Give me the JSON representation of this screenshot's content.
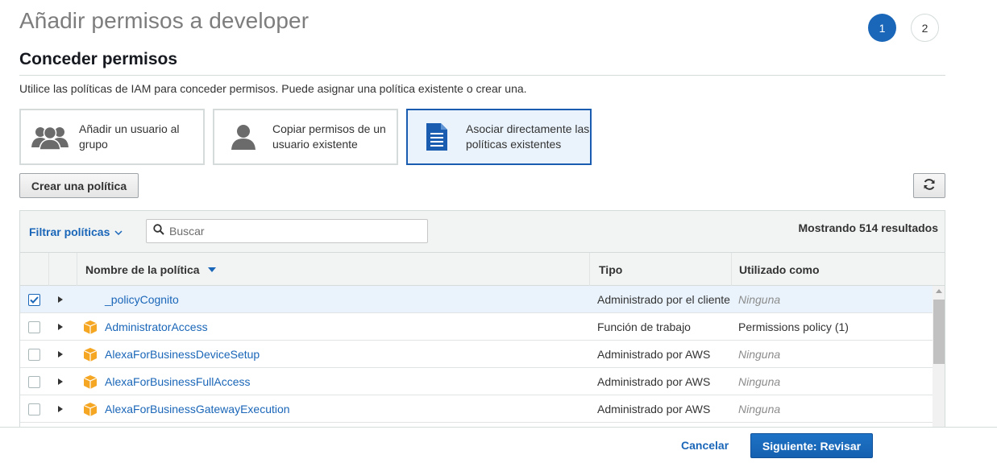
{
  "page": {
    "title": "Añadir permisos a developer",
    "steps": [
      "1",
      "2"
    ]
  },
  "section": {
    "title": "Conceder permisos",
    "description": "Utilice las políticas de IAM para conceder permisos. Puede asignar una política existente o crear una."
  },
  "options": [
    {
      "label": "Añadir un usuario al grupo",
      "icon": "users-group-icon",
      "selected": false
    },
    {
      "label": "Copiar permisos de un usuario existente",
      "icon": "user-icon",
      "selected": false
    },
    {
      "label": "Asociar directamente las políticas existentes",
      "icon": "document-icon",
      "selected": true
    }
  ],
  "actions": {
    "create_policy": "Crear una política",
    "refresh_icon": "refresh-icon"
  },
  "table": {
    "filter_label": "Filtrar políticas",
    "search_placeholder": "Buscar",
    "results_text": "Mostrando 514 resultados",
    "columns": {
      "name": "Nombre de la política",
      "type": "Tipo",
      "used_as": "Utilizado como"
    },
    "rows": [
      {
        "name": "_policyCognito",
        "type": "Administrado por el cliente",
        "used_as": "Ninguna",
        "checked": true,
        "icon": ""
      },
      {
        "name": "AdministratorAccess",
        "type": "Función de trabajo",
        "used_as": "Permissions policy (1)",
        "checked": false,
        "icon": "aws-package-icon"
      },
      {
        "name": "AlexaForBusinessDeviceSetup",
        "type": "Administrado por AWS",
        "used_as": "Ninguna",
        "checked": false,
        "icon": "aws-package-icon"
      },
      {
        "name": "AlexaForBusinessFullAccess",
        "type": "Administrado por AWS",
        "used_as": "Ninguna",
        "checked": false,
        "icon": "aws-package-icon"
      },
      {
        "name": "AlexaForBusinessGatewayExecution",
        "type": "Administrado por AWS",
        "used_as": "Ninguna",
        "checked": false,
        "icon": "aws-package-icon"
      }
    ]
  },
  "footer": {
    "cancel": "Cancelar",
    "next": "Siguiente: Revisar"
  },
  "colors": {
    "accent": "#1a66b8",
    "package": "#f5a623"
  }
}
